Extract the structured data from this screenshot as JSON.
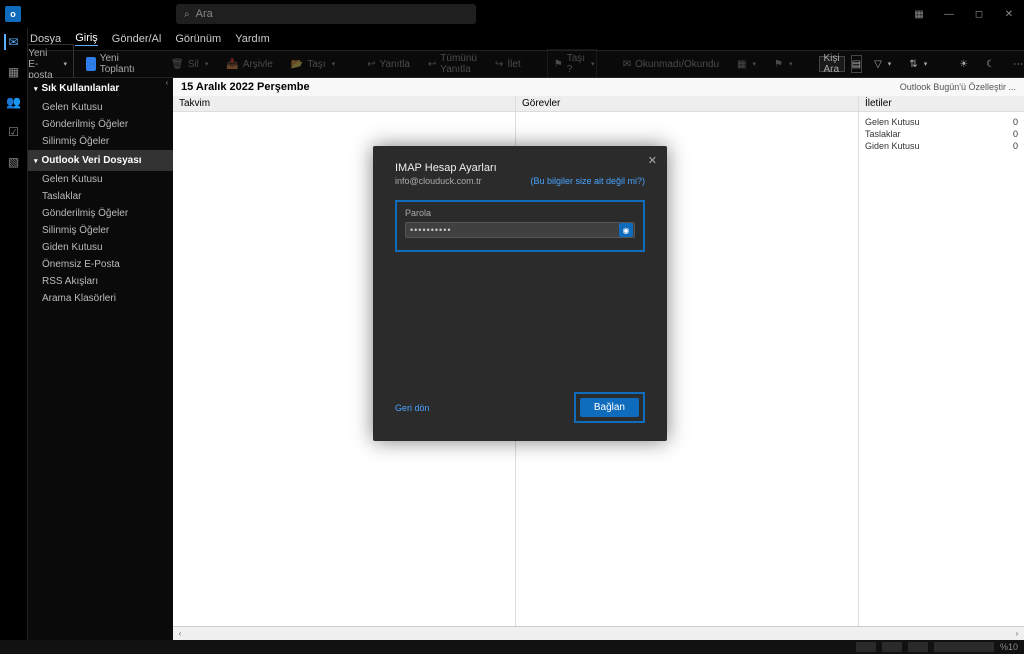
{
  "titlebar": {
    "search_placeholder": "Ara"
  },
  "menubar": {
    "items": [
      "Dosya",
      "Giriş",
      "Gönder/Al",
      "Görünüm",
      "Yardım"
    ],
    "active_index": 1
  },
  "ribbon": {
    "new_email": "Yeni E-posta",
    "new_meeting": "Yeni Toplantı",
    "delete": "Sil",
    "archive": "Arşivle",
    "move": "Taşı",
    "reply": "Yanıtla",
    "reply_all": "Tümünü Yanıtla",
    "forward": "İlet",
    "move_to": "Taşı ?",
    "read_unread": "Okunmadı/Okundu",
    "search_people": "Kişi Ara"
  },
  "folders": {
    "favorites_header": "Sık Kullanılanlar",
    "favorites": [
      "Gelen Kutusu",
      "Gönderilmiş Öğeler",
      "Silinmiş Öğeler"
    ],
    "datafile_header": "Outlook Veri Dosyası",
    "datafile": [
      "Gelen Kutusu",
      "Taslaklar",
      "Gönderilmiş Öğeler",
      "Silinmiş Öğeler",
      "Giden Kutusu",
      "Önemsiz E-Posta",
      "RSS Akışları",
      "Arama Klasörleri"
    ]
  },
  "content": {
    "date_header": "15 Aralık 2022 Perşembe",
    "customize": "Outlook Bugün'ü Özelleştir ...",
    "panel_calendar": "Takvim",
    "panel_tasks": "Görevler",
    "panel_messages": "İletiler",
    "msg_rows": [
      {
        "name": "Gelen Kutusu",
        "count": "0"
      },
      {
        "name": "Taslaklar",
        "count": "0"
      },
      {
        "name": "Giden Kutusu",
        "count": "0"
      }
    ]
  },
  "modal": {
    "title": "IMAP Hesap Ayarları",
    "email": "info@clouduck.com.tr",
    "not_you": "(Bu bilgiler size ait değil mi?)",
    "password_label": "Parola",
    "password_value": "**********",
    "back": "Geri dön",
    "connect": "Bağlan"
  },
  "statusbar": {
    "zoom": "%10"
  }
}
